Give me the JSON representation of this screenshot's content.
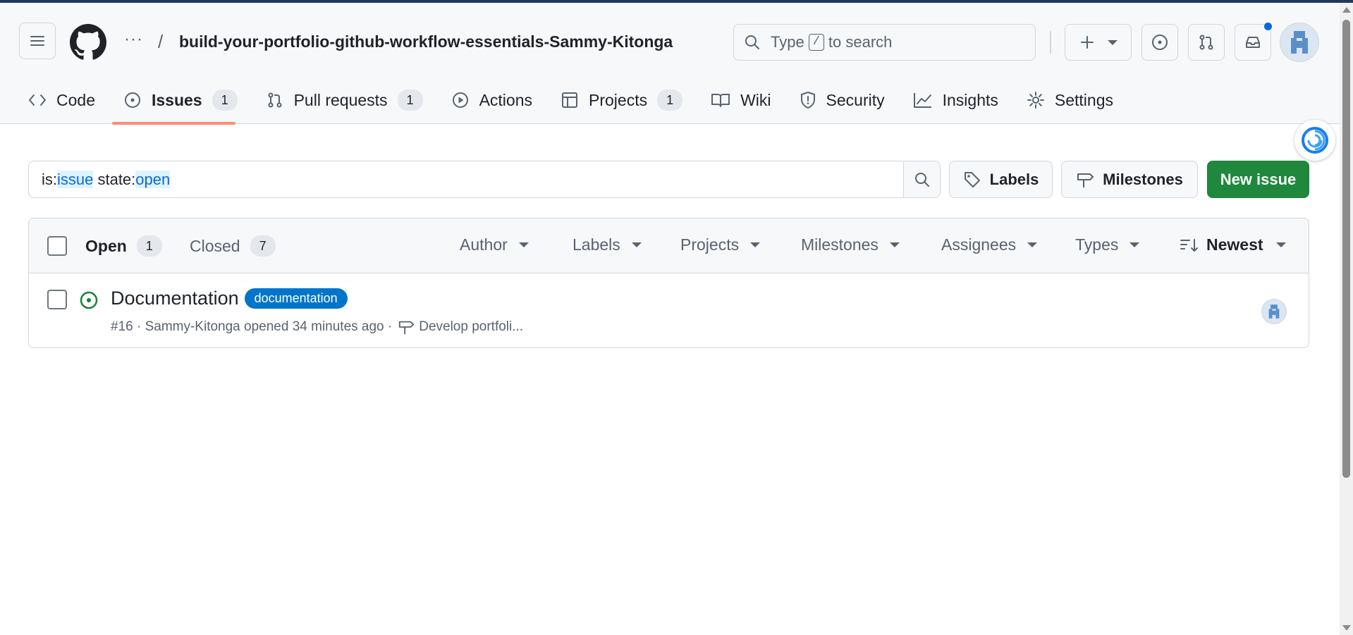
{
  "header": {
    "more_label": "···",
    "separator": "/",
    "repo_name": "build-your-portfolio-github-workflow-essentials-Sammy-Kitonga",
    "search": {
      "prefix": "Type",
      "key": "/",
      "suffix": "to search"
    }
  },
  "tabs": [
    {
      "label": "Code",
      "icon": "code-icon"
    },
    {
      "label": "Issues",
      "icon": "issue-opened-icon",
      "count": "1",
      "active": true
    },
    {
      "label": "Pull requests",
      "icon": "pull-request-icon",
      "count": "1"
    },
    {
      "label": "Actions",
      "icon": "play-icon"
    },
    {
      "label": "Projects",
      "icon": "table-icon",
      "count": "1"
    },
    {
      "label": "Wiki",
      "icon": "book-icon"
    },
    {
      "label": "Security",
      "icon": "shield-icon"
    },
    {
      "label": "Insights",
      "icon": "graph-icon"
    },
    {
      "label": "Settings",
      "icon": "gear-icon"
    }
  ],
  "filter": {
    "q1": "is:",
    "q2": "issue",
    "q3": " state:",
    "q4": "open"
  },
  "buttons": {
    "labels": "Labels",
    "milestones": "Milestones",
    "new_issue": "New issue"
  },
  "list": {
    "open_label": "Open",
    "open_count": "1",
    "closed_label": "Closed",
    "closed_count": "7",
    "filters": [
      "Author",
      "Labels",
      "Projects",
      "Milestones",
      "Assignees",
      "Types"
    ],
    "sort": "Newest"
  },
  "issues": [
    {
      "title": "Documentation",
      "label": "documentation",
      "label_color": "#0075ca",
      "meta": "#16 · Sammy-Kitonga opened 34 minutes ago ·",
      "milestone": "Develop portfoli..."
    }
  ],
  "colors": {
    "accent_underline": "#fd8c73",
    "primary_button": "#1f883d",
    "open_icon": "#1a7f37",
    "notification_dot": "#0969da"
  }
}
